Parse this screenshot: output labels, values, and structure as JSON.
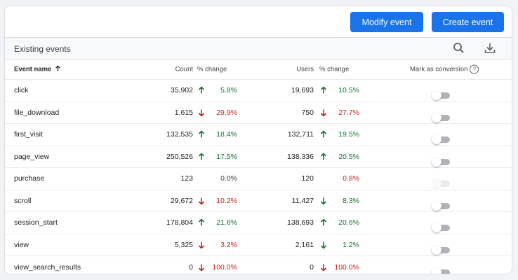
{
  "toolbar": {
    "modify_label": "Modify event",
    "create_label": "Create event"
  },
  "section": {
    "title": "Existing events"
  },
  "columns": {
    "name": "Event name",
    "count": "Count",
    "count_change": "% change",
    "users": "Users",
    "users_change": "% change",
    "conversion": "Mark as conversion",
    "help": "?"
  },
  "colors": {
    "accent": "#1a73e8",
    "up": "#137333",
    "down": "#c5221f"
  },
  "rows": [
    {
      "name": "click",
      "count": "35,902",
      "count_change": "5.8%",
      "count_dir": "up",
      "users": "19,693",
      "users_change": "10.5%",
      "users_dir": "up",
      "toggle": "off"
    },
    {
      "name": "file_download",
      "count": "1,615",
      "count_change": "29.9%",
      "count_dir": "down",
      "users": "750",
      "users_change": "27.7%",
      "users_dir": "down",
      "toggle": "off"
    },
    {
      "name": "first_visit",
      "count": "132,535",
      "count_change": "18.4%",
      "count_dir": "up",
      "users": "132,711",
      "users_change": "19.5%",
      "users_dir": "up",
      "toggle": "off"
    },
    {
      "name": "page_view",
      "count": "250,526",
      "count_change": "17.5%",
      "count_dir": "up",
      "users": "138,336",
      "users_change": "20.5%",
      "users_dir": "up",
      "toggle": "off"
    },
    {
      "name": "purchase",
      "count": "123",
      "count_change": "0.0%",
      "count_dir": "none",
      "users": "120",
      "users_change": "0.8%",
      "users_dir": "none-red",
      "toggle": "disabled"
    },
    {
      "name": "scroll",
      "count": "29,672",
      "count_change": "10.2%",
      "count_dir": "down",
      "users": "11,427",
      "users_change": "8.3%",
      "users_dir": "down-green",
      "toggle": "off"
    },
    {
      "name": "session_start",
      "count": "178,804",
      "count_change": "21.6%",
      "count_dir": "up",
      "users": "138,693",
      "users_change": "20.6%",
      "users_dir": "up",
      "toggle": "off"
    },
    {
      "name": "view",
      "count": "5,325",
      "count_change": "3.2%",
      "count_dir": "down",
      "users": "2,161",
      "users_change": "1.2%",
      "users_dir": "down-green",
      "toggle": "off"
    },
    {
      "name": "view_search_results",
      "count": "0",
      "count_change": "100.0%",
      "count_dir": "down",
      "users": "0",
      "users_change": "100.0%",
      "users_dir": "down",
      "toggle": "off"
    }
  ]
}
